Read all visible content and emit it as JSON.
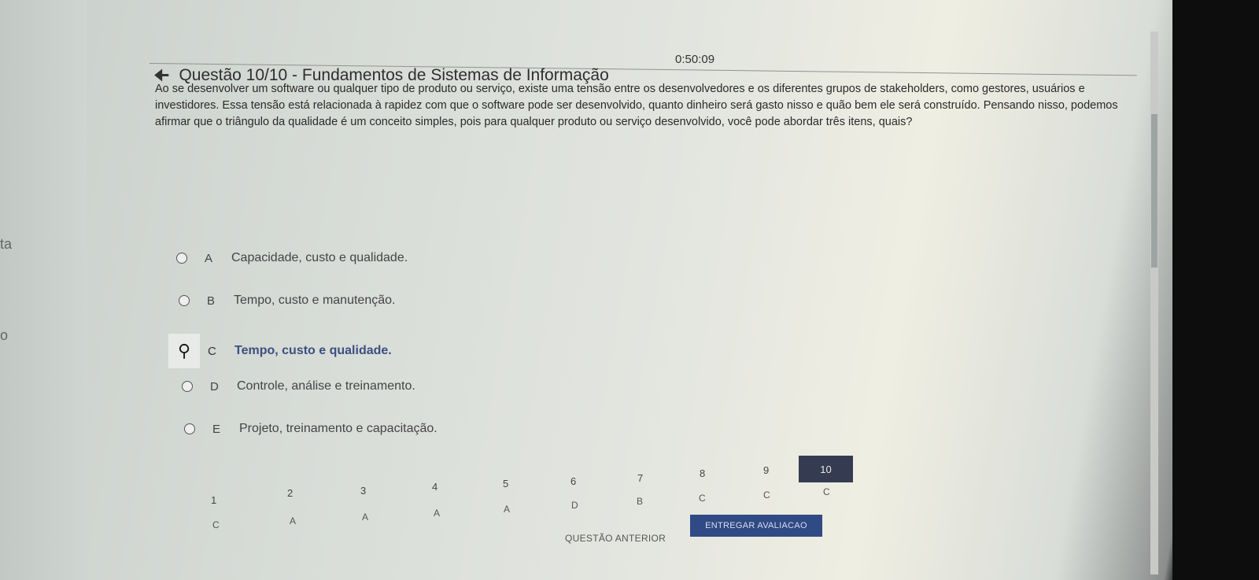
{
  "timer": "0:50:09",
  "title": "Questão 10/10 - Fundamentos de Sistemas de Informação",
  "question": "Ao se desenvolver um software ou qualquer tipo de produto ou serviço, existe uma tensão entre os desenvolvedores e os diferentes grupos de stakeholders, como gestores, usuários e investidores. Essa tensão está relacionada à rapidez com que o software pode ser desenvolvido, quanto dinheiro será gasto nisso e quão bem ele será construído. Pensando nisso, podemos afirmar que o triângulo da qualidade é um conceito simples, pois para qualquer produto ou serviço desenvolvido, você pode abordar três itens, quais?",
  "options": [
    {
      "letter": "A",
      "text": "Capacidade, custo e qualidade."
    },
    {
      "letter": "B",
      "text": "Tempo, custo e manutenção."
    },
    {
      "letter": "C",
      "text": "Tempo, custo e qualidade."
    },
    {
      "letter": "D",
      "text": "Controle, análise e treinamento."
    },
    {
      "letter": "E",
      "text": "Projeto, treinamento e capacitação."
    }
  ],
  "selected_option": "C",
  "nav": [
    {
      "num": "1",
      "answer": "C"
    },
    {
      "num": "2",
      "answer": "A"
    },
    {
      "num": "3",
      "answer": "A"
    },
    {
      "num": "4",
      "answer": "A"
    },
    {
      "num": "5",
      "answer": "A"
    },
    {
      "num": "6",
      "answer": "D"
    },
    {
      "num": "7",
      "answer": "B"
    },
    {
      "num": "8",
      "answer": "C"
    },
    {
      "num": "9",
      "answer": "C"
    },
    {
      "num": "10",
      "answer": "C"
    }
  ],
  "prev_label": "QUESTÃO ANTERIOR",
  "submit_label": "ENTREGAR AVALIACAO",
  "left_fragments": [
    "ta",
    "o"
  ]
}
